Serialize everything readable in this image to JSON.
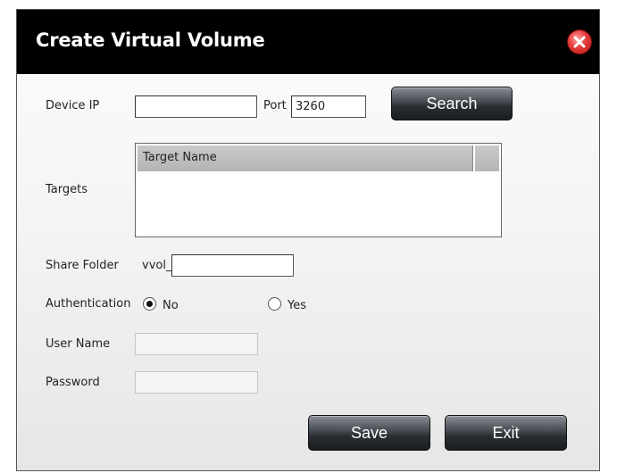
{
  "dialog": {
    "title": "Create Virtual Volume"
  },
  "form": {
    "device_ip_label": "Device IP",
    "device_ip_value": "",
    "port_label": "Port",
    "port_value": "3260",
    "search_label": "Search",
    "targets_label": "Targets",
    "targets_column_header": "Target Name",
    "share_folder_label": "Share Folder",
    "share_folder_prefix": "vvol_",
    "share_folder_value": "",
    "authentication_label": "Authentication",
    "auth_options": [
      {
        "label": "No",
        "selected": true
      },
      {
        "label": "Yes",
        "selected": false
      }
    ],
    "user_name_label": "User Name",
    "user_name_value": "",
    "password_label": "Password",
    "password_value": ""
  },
  "footer": {
    "save_label": "Save",
    "exit_label": "Exit"
  },
  "colors": {
    "title_bar": "#000000",
    "close_button": "#e53b3b",
    "button_dark": "#2a2e33"
  },
  "icons": {
    "close": "close-icon"
  }
}
